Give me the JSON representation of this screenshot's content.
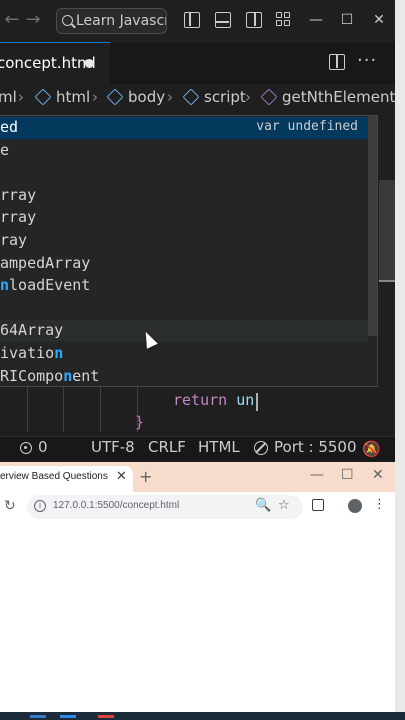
{
  "vscode": {
    "command_center": "Learn Javascript",
    "nav_back": "←",
    "nav_forward": "→",
    "window_controls": {
      "minimize": "—",
      "maximize": "☐",
      "close": "✕"
    },
    "tab": {
      "label": "concept.html",
      "unsaved": true
    },
    "more": "···",
    "breadcrumb": [
      "ml",
      "html",
      "body",
      "script",
      "getNthElement"
    ],
    "suggestions": [
      {
        "pre": "",
        "match": "",
        "post": "ed",
        "detail": "var undefined",
        "selected": true
      },
      {
        "pre": "",
        "match": "",
        "post": "e",
        "detail": ""
      },
      {
        "pre": "",
        "match": "",
        "post": "",
        "detail": ""
      },
      {
        "pre": "",
        "match": "",
        "post": "rray",
        "detail": ""
      },
      {
        "pre": "",
        "match": "",
        "post": "rray",
        "detail": ""
      },
      {
        "pre": "",
        "match": "",
        "post": "ray",
        "detail": ""
      },
      {
        "pre": "",
        "match": "",
        "post": "ampedArray",
        "detail": ""
      },
      {
        "pre": "",
        "match": "n",
        "post": "loadEvent",
        "detail": ""
      },
      {
        "pre": "",
        "match": "",
        "post": "",
        "detail": ""
      },
      {
        "pre": "",
        "match": "",
        "post": "64Array",
        "detail": "",
        "hover": true
      },
      {
        "pre": "ivatio",
        "match": "n",
        "post": "",
        "detail": ""
      },
      {
        "pre": "RICompo",
        "match": "n",
        "post": "ent",
        "detail": ""
      }
    ],
    "code": {
      "keyword": "return",
      "typed": "un",
      "brace": "}"
    },
    "status": {
      "ports": "0",
      "encoding": "UTF-8",
      "eol": "CRLF",
      "language": "HTML",
      "port": "Port : 5500"
    }
  },
  "chrome": {
    "tab_title": "erview Based Questions",
    "tab_close": "✕",
    "new_tab": "+",
    "window_controls": {
      "minimize": "—",
      "maximize": "☐",
      "close": "✕"
    },
    "url": "127.0.0.1:5500/concept.html",
    "info_icon": "i",
    "reload": "↻",
    "menu": "⋮"
  }
}
